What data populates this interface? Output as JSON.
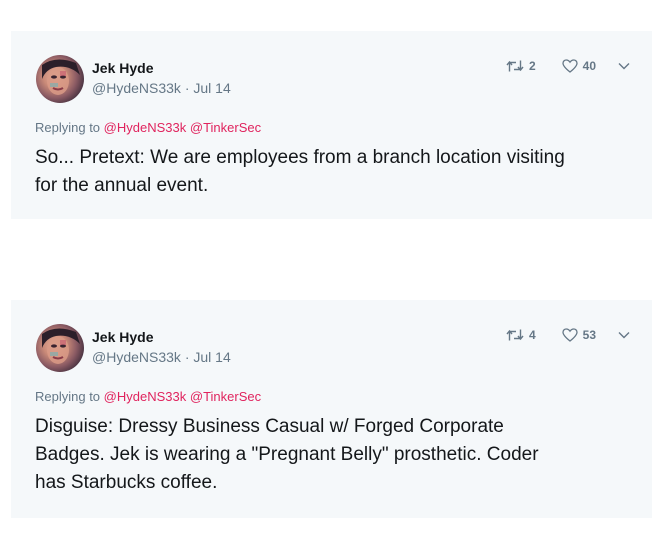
{
  "tweets": [
    {
      "author_name": "Jek Hyde",
      "handle": "@HydeNS33k",
      "separator": "·",
      "date": "Jul 14",
      "retweet_count": "2",
      "like_count": "40",
      "replying_prefix": "Replying to",
      "mentions": [
        "@HydeNS33k",
        "@TinkerSec"
      ],
      "text_lines": [
        "So... Pretext: We are employees from a branch location visiting",
        "for the annual event."
      ]
    },
    {
      "author_name": "Jek Hyde",
      "handle": "@HydeNS33k",
      "separator": "·",
      "date": "Jul 14",
      "retweet_count": "4",
      "like_count": "53",
      "replying_prefix": "Replying to",
      "mentions": [
        "@HydeNS33k",
        "@TinkerSec"
      ],
      "text_lines": [
        "Disguise: Dressy Business Casual w/ Forged Corporate",
        "Badges. Jek is wearing a \"Pregnant Belly\" prosthetic. Coder",
        "has Starbucks coffee."
      ]
    }
  ],
  "icons": {
    "retweet": "retweet-icon",
    "like": "heart-icon",
    "more": "chevron-down-icon"
  },
  "colors": {
    "card_background": "#f5f8fa",
    "text": "#14171a",
    "secondary_text": "#657786",
    "mention": "#e0245e"
  }
}
